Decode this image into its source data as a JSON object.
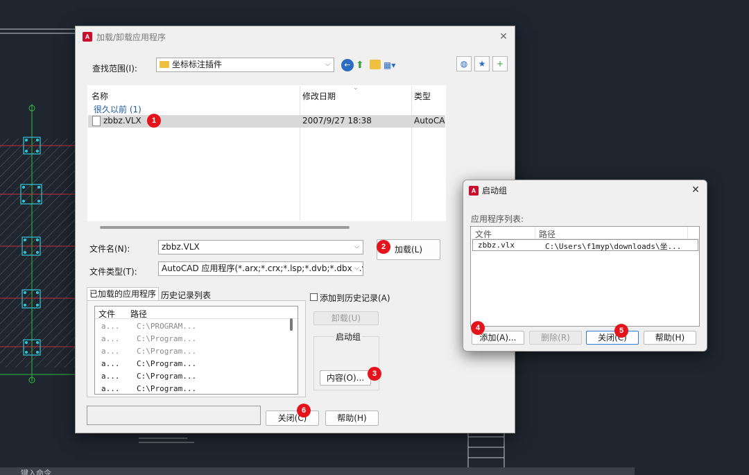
{
  "colors": {
    "badge": "#e3141b",
    "selection": "#d9d9d9",
    "group_header": "#1f5aa6",
    "cad_bg": "#1f2630",
    "cad_red": "#c8303a",
    "cad_green": "#2fbf3f",
    "cad_cyan": "#30c8d8"
  },
  "main": {
    "title": "加载/卸载应用程序",
    "lookin_label": "查找范围(I):",
    "lookin_value": "坐标标注插件",
    "file_list": {
      "columns": [
        "名称",
        "修改日期",
        "类型"
      ],
      "group": "很久以前 (1)",
      "files": [
        {
          "name": "zbbz.VLX",
          "date": "2007/9/27 18:38",
          "type": "AutoCAD"
        }
      ]
    },
    "filename_label": "文件名(N):",
    "filename_value": "zbbz.VLX",
    "filetype_label": "文件类型(T):",
    "filetype_value": "AutoCAD 应用程序(*.arx;*.crx;*.lsp;*.dvb;*.dbx;*.v",
    "load_button": "加载(L)",
    "tabs": [
      "已加载的应用程序",
      "历史记录列表"
    ],
    "loaded": {
      "columns": [
        "文件",
        "路径"
      ],
      "rows": [
        {
          "file": "a...",
          "path": "C:\\PROGRAM..."
        },
        {
          "file": "a...",
          "path": "C:\\Program..."
        },
        {
          "file": "a...",
          "path": "C:\\Program..."
        },
        {
          "file": "a...",
          "path": "C:\\Program..."
        },
        {
          "file": "a...",
          "path": "C:\\Program..."
        },
        {
          "file": "a...",
          "path": "C:\\Program..."
        }
      ]
    },
    "add_history_label": "添加到历史记录(A)",
    "unload_button": "卸载(U)",
    "startup_group_label": "启动组",
    "contents_button": "内容(O)...",
    "close_button": "关闭(C)",
    "help_button": "帮助(H)"
  },
  "startup": {
    "title": "启动组",
    "list_label": "应用程序列表:",
    "columns": [
      "文件",
      "路径"
    ],
    "rows": [
      {
        "file": "zbbz.vlx",
        "path": "C:\\Users\\f1myp\\downloads\\坐..."
      }
    ],
    "add_button": "添加(A)...",
    "remove_button": "删除(R)",
    "close_button": "关闭(C)",
    "help_button": "帮助(H)"
  },
  "badges": [
    "1",
    "2",
    "3",
    "4",
    "5",
    "6"
  ],
  "command_line_text": "键入命令"
}
